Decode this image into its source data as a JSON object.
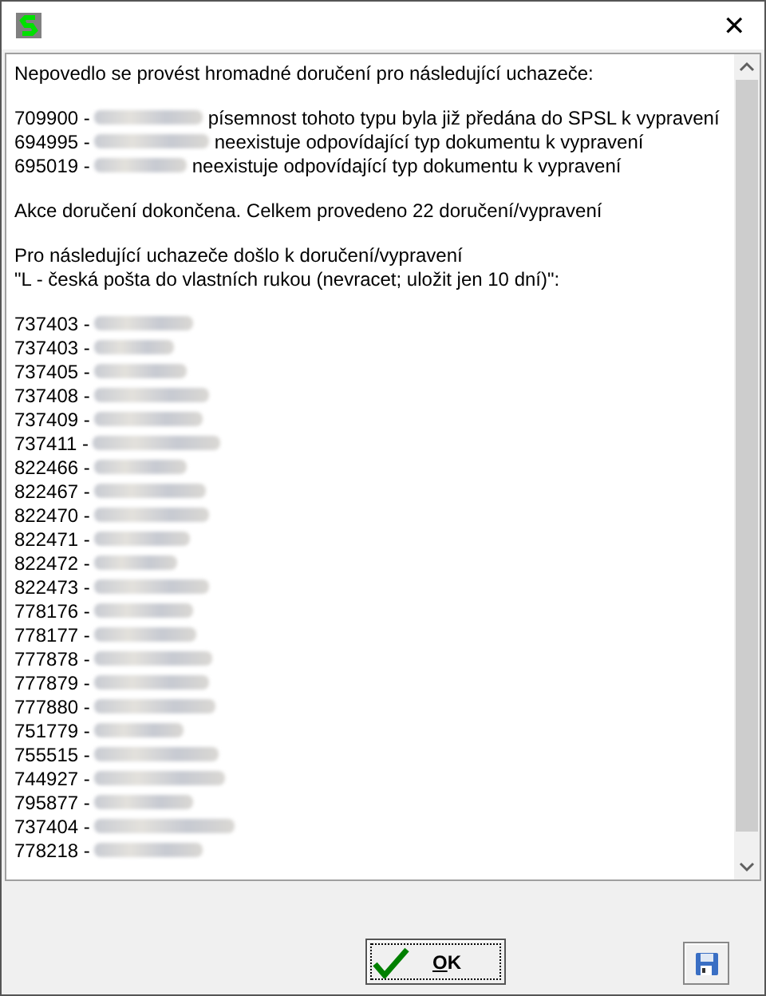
{
  "window": {
    "close_glyph": "✕"
  },
  "message": {
    "header": "Nepovedlo se provést hromadné doručení pro následující uchazeče:",
    "failures": [
      {
        "id": "709900 -",
        "note": "písemnost tohoto typu byla již předána do SPSL k vypravení"
      },
      {
        "id": "694995 -",
        "note": "neexistuje odpovídající typ dokumentu k vypravení"
      },
      {
        "id": "695019 -",
        "note": "neexistuje odpovídající typ dokumentu k vypravení"
      }
    ],
    "summary": "Akce doručení dokončena. Celkem provedeno 22 doručení/vypravení",
    "delivered_intro": "Pro následující uchazeče došlo k doručení/vypravení",
    "delivered_method": "\"L - česká pošta do vlastních rukou (nevracet; uložit jen 10 dní)\":",
    "deliveries": [
      {
        "id": "737403 -"
      },
      {
        "id": "737403 -"
      },
      {
        "id": "737405 -"
      },
      {
        "id": "737408 -"
      },
      {
        "id": "737409 -"
      },
      {
        "id": "737411 -"
      },
      {
        "id": "822466 -"
      },
      {
        "id": "822467 -"
      },
      {
        "id": "822470 -"
      },
      {
        "id": "822471 -"
      },
      {
        "id": "822472 -"
      },
      {
        "id": "822473 -"
      },
      {
        "id": "778176 -"
      },
      {
        "id": "778177 -"
      },
      {
        "id": "777878 -"
      },
      {
        "id": "777879 -"
      },
      {
        "id": "777880 -"
      },
      {
        "id": "751779 -"
      },
      {
        "id": "755515 -"
      },
      {
        "id": "744927 -"
      },
      {
        "id": "795877 -"
      },
      {
        "id": "737404 -"
      },
      {
        "id": "778218 -"
      }
    ]
  },
  "buttons": {
    "ok": {
      "mnemonic": "O",
      "rest": "K"
    }
  }
}
